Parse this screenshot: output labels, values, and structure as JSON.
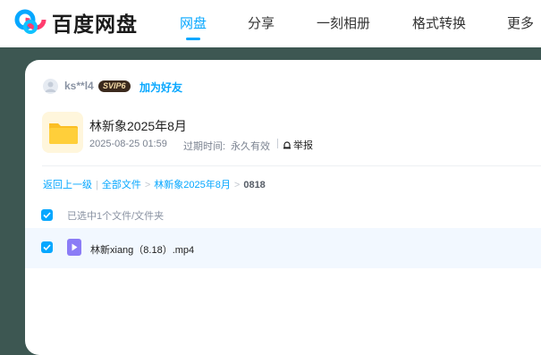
{
  "app": {
    "brand": "百度网盘"
  },
  "nav": {
    "items": [
      {
        "label": "网盘",
        "active": true
      },
      {
        "label": "分享",
        "active": false
      },
      {
        "label": "一刻相册",
        "active": false
      },
      {
        "label": "格式转换",
        "active": false
      },
      {
        "label": "更多",
        "active": false
      }
    ]
  },
  "sharer": {
    "username": "ks**l4",
    "vip_badge": "SVIP6",
    "add_friend": "加为好友"
  },
  "share": {
    "title": "林新象2025年8月",
    "date": "2025-08-25 01:59",
    "expiry_label": "过期时间:",
    "expiry_value": "永久有效",
    "report": "举报",
    "icon": "folder-icon"
  },
  "breadcrumb": {
    "back": "返回上一级",
    "all_files": "全部文件",
    "folder": "林新象2025年8月",
    "current": "0818"
  },
  "selection": {
    "text": "已选中1个文件/文件夹"
  },
  "files": [
    {
      "name": "林新xiang（8.18）.mp4",
      "checked": true,
      "icon": "video-file-icon"
    }
  ],
  "colors": {
    "accent": "#06a7ff",
    "background": "#3d5752",
    "row_highlight": "#f2f8ff"
  }
}
